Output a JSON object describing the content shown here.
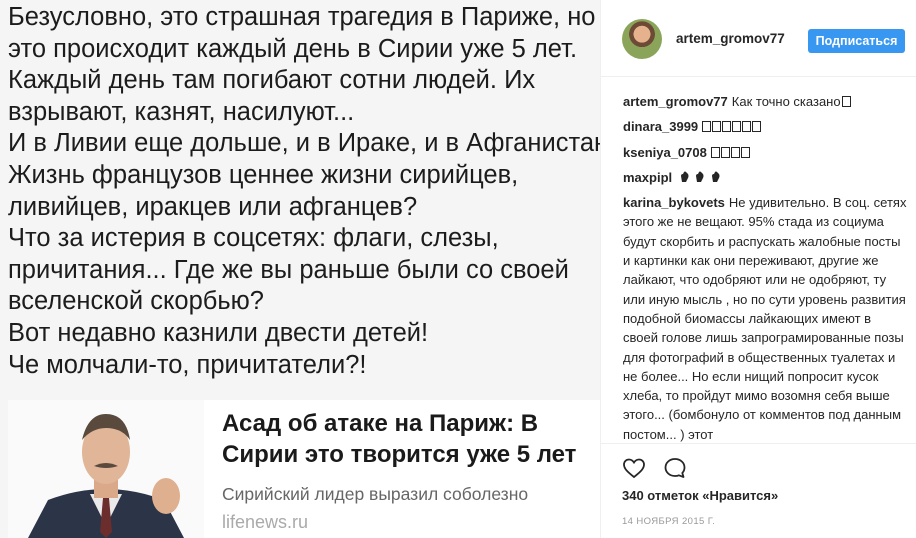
{
  "post_image": {
    "lines": [
      "Безусловно, это страшная трагедия в Париже, но",
      "это происходит каждый день в Сирии уже 5 лет.",
      "Каждый день там погибают сотни людей. Их",
      "взрывают, казнят, насилуют...",
      "И в Ливии еще дольше, и в Ираке, и в Афганистане.",
      "Жизнь французов ценнее жизни сирийцев,",
      "ливийцев, иракцев или афганцев?",
      "Что за истерия в соцсетях: флаги, слезы,",
      "причитания... Где же вы раньше были со своей",
      "вселенской скорбью?",
      "Вот недавно казнили двести детей!",
      "Че молчали-то, причитатели?!"
    ],
    "news_card": {
      "headline_line1": "Асад об атаке на Париж: В",
      "headline_line2": "Сирии это творится уже 5 лет",
      "subtitle": "Сирийский лидер выразил соболезно",
      "source": "lifenews.ru"
    }
  },
  "header": {
    "username": "artem_gromov77",
    "follow_label": "Подписаться"
  },
  "comments": [
    {
      "user": "artem_gromov77",
      "text": "Как точно сказано"
    },
    {
      "user": "dinara_3999",
      "text": ""
    },
    {
      "user": "kseniya_0708",
      "text": ""
    },
    {
      "user": "maxpipl",
      "text": ""
    },
    {
      "user": "karina_bykovets",
      "text": "Не удивительно. В соц. сетях этого же не вещают. 95% стада из социума будут скорбить и распускать жалобные посты и картинки как они переживают, другие же лайкают, что одобряют или не одобряют, ту или иную мысль , но по сути уровень развития подобной биомассы лайкающих имеют в своей голове лишь запрограмированные позы для фотографий в общественных туалетах и не более... Но если нищий попросит кусок хлеба, то пройдут мимо возомня себя выше этого... (бомбонуло от комментов под данным постом... ) этот"
    }
  ],
  "actions": {
    "likes_label": "340 отметок «Нравится»",
    "date_label": "14 НОЯБРЯ 2015 Г."
  },
  "icons": {
    "like": "heart-outline-icon",
    "comment": "speech-bubble-icon"
  },
  "colors": {
    "follow_button": "#3897f0",
    "text": "#262626",
    "meta": "#999999"
  }
}
